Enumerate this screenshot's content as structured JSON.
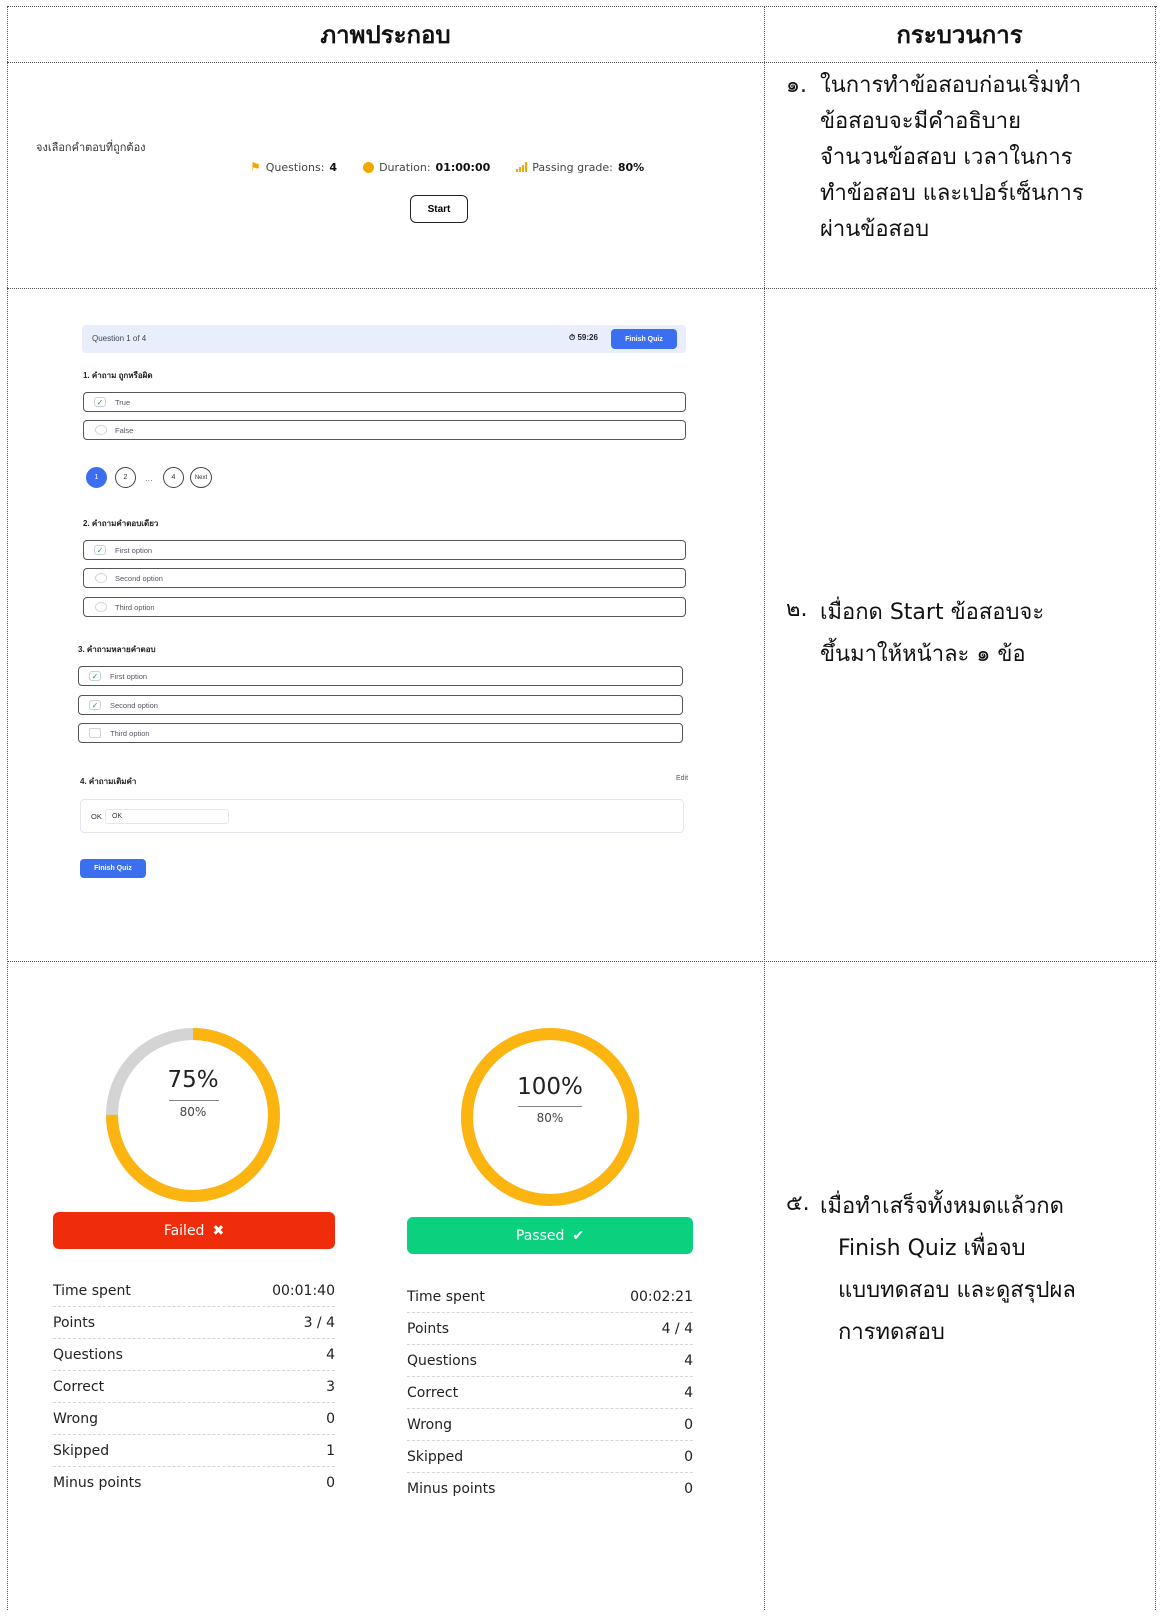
{
  "table": {
    "col_illustration": "ภาพประกอบ",
    "col_process": "กระบวนการ"
  },
  "rows": [
    {
      "num": "๑.",
      "lines": [
        "ในการทำข้อสอบก่อนเริ่มทำ",
        "ข้อสอบจะมีคำอธิบาย",
        "จำนวนข้อสอบ เวลาในการ",
        "ทำข้อสอบ และเปอร์เซ็นการ",
        "ผ่านข้อสอบ"
      ]
    },
    {
      "num": "๒.",
      "lines": [
        "เมื่อกด Start ข้อสอบจะ",
        "ขึ้นมาให้หน้าละ ๑ ข้อ"
      ]
    },
    {
      "num": "๕.",
      "lines": [
        "เมื่อทำเสร็จทั้งหมดแล้วกด",
        "Finish Quiz เพื่อจบ",
        "แบบทดสอบ และดูสรุปผล",
        "การทดสอบ"
      ]
    }
  ],
  "intro": {
    "instruction": "จงเลือกคำตอบที่ถูกต้อง",
    "questions_label": "Questions:",
    "questions_value": "4",
    "duration_label": "Duration:",
    "duration_value": "01:00:00",
    "passing_label": "Passing grade:",
    "passing_value": "80%",
    "start_label": "Start"
  },
  "quiz": {
    "progress_label": "Question 1 of 4",
    "timer": "59:26",
    "finish_label": "Finish Quiz",
    "q1": {
      "title": "1. คำถาม ถูกหรือผิด",
      "options": [
        "True",
        "False"
      ]
    },
    "pagination": {
      "p1": "1",
      "p2": "2",
      "dots": "...",
      "p4": "4",
      "next": "Next"
    },
    "q2": {
      "title": "2. คำถามคำตอบเดียว",
      "options": [
        "First option",
        "Second option",
        "Third option"
      ]
    },
    "q3": {
      "title": "3. คำถามหลายคำตอบ",
      "options": [
        "First option",
        "Second option",
        "Third option"
      ]
    },
    "q4": {
      "title": "4. คำถามเติมคำ",
      "edit": "Edit",
      "prefix": "OK",
      "answer": "OK"
    }
  },
  "results": {
    "failed": {
      "score": "75%",
      "score_fraction": 0.75,
      "passing": "80%",
      "status_label": "Failed",
      "stats": [
        {
          "label": "Time spent",
          "value": "00:01:40"
        },
        {
          "label": "Points",
          "value": "3 / 4"
        },
        {
          "label": "Questions",
          "value": "4"
        },
        {
          "label": "Correct",
          "value": "3"
        },
        {
          "label": "Wrong",
          "value": "0"
        },
        {
          "label": "Skipped",
          "value": "1"
        },
        {
          "label": "Minus points",
          "value": "0"
        }
      ]
    },
    "passed": {
      "score": "100%",
      "score_fraction": 1.0,
      "passing": "80%",
      "status_label": "Passed",
      "stats": [
        {
          "label": "Time spent",
          "value": "00:02:21"
        },
        {
          "label": "Points",
          "value": "4 / 4"
        },
        {
          "label": "Questions",
          "value": "4"
        },
        {
          "label": "Correct",
          "value": "4"
        },
        {
          "label": "Wrong",
          "value": "0"
        },
        {
          "label": "Skipped",
          "value": "0"
        },
        {
          "label": "Minus points",
          "value": "0"
        }
      ]
    },
    "colors": {
      "ring_fill": "#fbb410",
      "ring_track": "#d4d4d4",
      "failed": "#ef2d0a",
      "passed": "#0bd07e",
      "primary": "#3b6ff0"
    }
  }
}
